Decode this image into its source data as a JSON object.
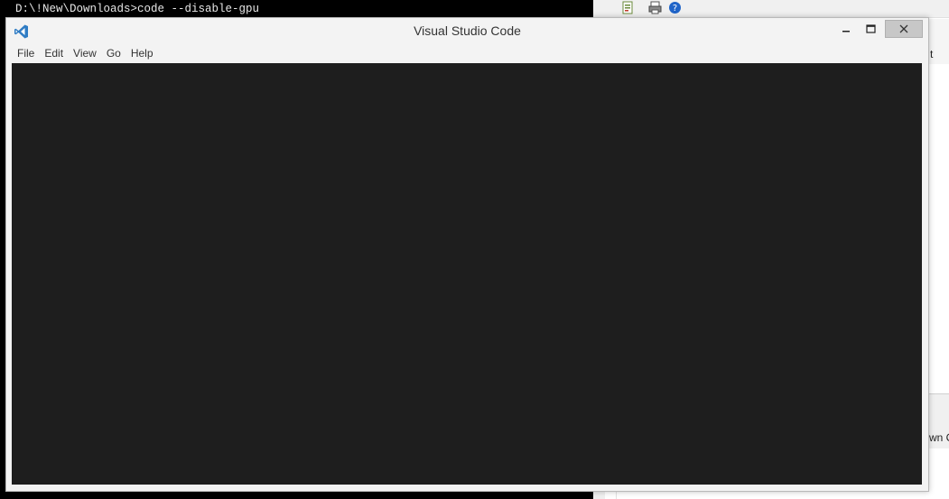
{
  "console": {
    "command_line": "D:\\!New\\Downloads>code --disable-gpu"
  },
  "right_app": {
    "toolbar_icons": [
      "document-icon",
      "print-icon",
      "help-icon"
    ],
    "tab_text": "t",
    "lower_text": "wn C"
  },
  "vscode": {
    "title": "Visual Studio Code",
    "menu": [
      {
        "label": "File"
      },
      {
        "label": "Edit"
      },
      {
        "label": "View"
      },
      {
        "label": "Go"
      },
      {
        "label": "Help"
      }
    ],
    "colors": {
      "editor_bg": "#1e1e1e",
      "titlebar_bg": "#f3f3f3",
      "brand_blue": "#2f7cc4"
    }
  }
}
